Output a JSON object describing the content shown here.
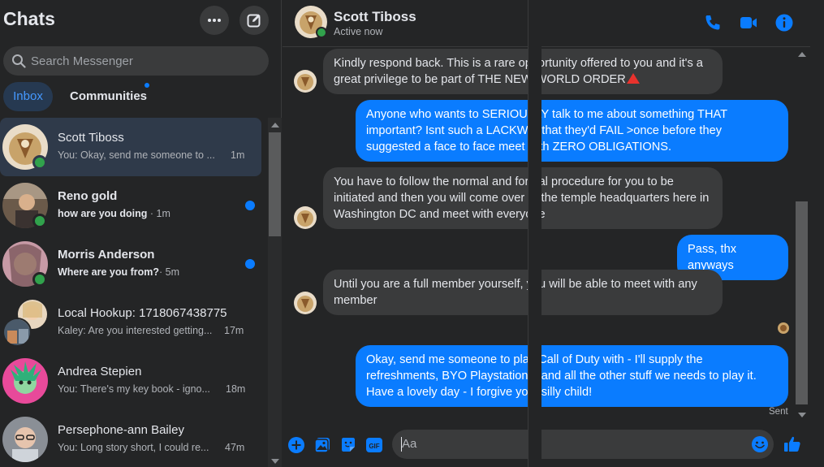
{
  "sidebar": {
    "title": "Chats",
    "more_icon": "more-horizontal-icon",
    "compose_icon": "compose-icon",
    "search": {
      "placeholder": "Search Messenger",
      "icon": "search-icon"
    },
    "tabs": [
      {
        "label": "Inbox",
        "selected": true
      },
      {
        "label": "Communities",
        "selected": false,
        "has_indicator": true
      }
    ],
    "chats": [
      {
        "name": "Scott Tiboss",
        "preview": "You: Okay, send me someone to ...",
        "time": "1m",
        "online": true,
        "unread": false,
        "active": true
      },
      {
        "name": "Reno gold",
        "preview": "how are you doing",
        "time": "· 1m",
        "online": true,
        "unread": true,
        "active": false
      },
      {
        "name": "Morris Anderson",
        "preview": "Where are you from?",
        "time": "· 5m",
        "online": true,
        "unread": true,
        "active": false
      },
      {
        "name": "Local Hookup: 1718067438775",
        "preview": "Kaley: Are you interested getting...",
        "time": "17m",
        "online": false,
        "unread": false,
        "active": false,
        "group": true
      },
      {
        "name": "Andrea Stepien",
        "preview": "You: There's my key book - igno...",
        "time": "18m",
        "online": false,
        "unread": false,
        "active": false
      },
      {
        "name": "Persephone-ann Bailey",
        "preview": "You: Long story short, I could re...",
        "time": "47m",
        "online": false,
        "unread": false,
        "active": false
      }
    ]
  },
  "conversation": {
    "contact_name": "Scott Tiboss",
    "contact_status": "Active now",
    "header_icons": [
      "phone-icon",
      "video-icon",
      "info-icon"
    ],
    "messages": [
      {
        "from": "them",
        "text": "Kindly respond back. This is a rare opportunity offered to you and it's a great privilege to be part of THE  NEW WORLD ORDER",
        "has_triangle": true
      },
      {
        "from": "me",
        "text": "Anyone who wants to SERIOUSLY talk to me about something THAT important? Isnt such a LACKWIT that they'd FAIL >once before they suggested a face to face meet with ZERO OBLIGATIONS."
      },
      {
        "from": "them",
        "text": "You have to follow the normal and formal procedure for you to be initiated and then you will come over to the temple headquarters here in Washington DC and meet with everyone"
      },
      {
        "from": "me",
        "text": "Pass, thx anyways"
      },
      {
        "from": "them",
        "text": "Until you are a full member yourself, you will be able to meet with any member"
      },
      {
        "from": "me",
        "text": "Okay, send me someone to play Call of Duty with - I'll supply the refreshments, BYO Playstation 5 and all the other stuff we needs to play it. Have a lovely day - I forgive you, silly child!"
      }
    ],
    "sent_label": "Sent"
  },
  "composer": {
    "placeholder": "Aa",
    "icons": [
      "plus-icon",
      "image-icon",
      "sticker-icon",
      "gif-icon",
      "emoji-icon",
      "like-icon"
    ]
  },
  "colors": {
    "background": "#242526",
    "bubble_incoming": "#3a3b3c",
    "bubble_outgoing": "#0a7cff",
    "accent": "#0a7cff",
    "online": "#31a24c"
  }
}
